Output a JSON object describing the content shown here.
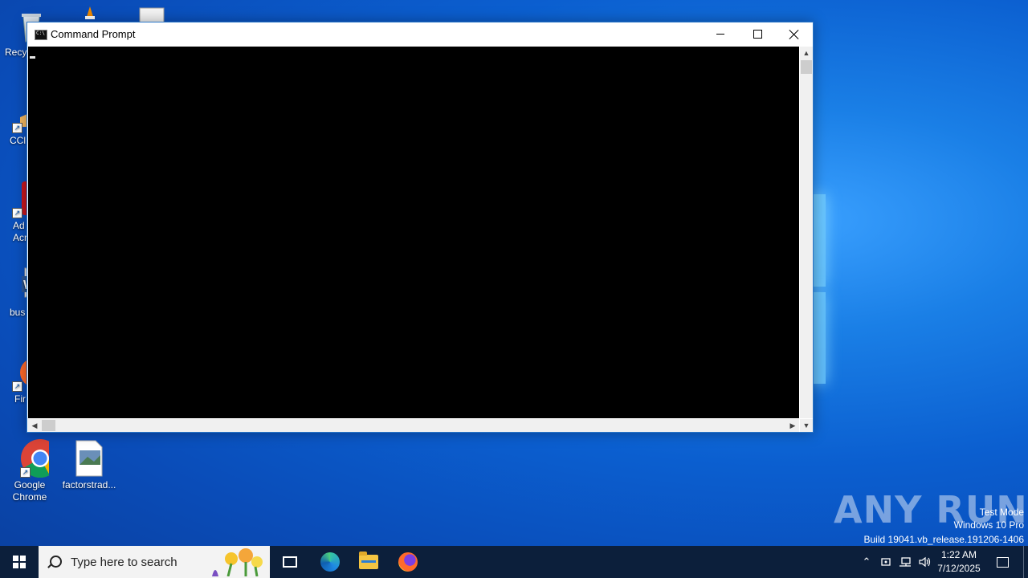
{
  "desktop": {
    "icons": [
      {
        "label": "Recy",
        "icon": "recycle-bin-icon"
      },
      {
        "label": "CCl",
        "icon": "ccleaner-icon"
      },
      {
        "label": "Ad Acr",
        "icon": "acrobat-icon"
      },
      {
        "label": "bus",
        "icon": "word-document-icon"
      },
      {
        "label": "Fir",
        "icon": "firefox-icon"
      },
      {
        "label": "Google Chrome",
        "icon": "chrome-icon"
      },
      {
        "label": "factorstrad...",
        "icon": "image-file-icon"
      }
    ]
  },
  "window": {
    "title": "Command Prompt",
    "icon": "cmd-icon",
    "controls": {
      "minimize": "minimize",
      "maximize": "maximize",
      "close": "close"
    }
  },
  "watermark": {
    "brand": "ANY RUN",
    "line1": "Test Mode",
    "line2": "Windows 10 Pro",
    "line3": "Build 19041.vb_release.191206-1406"
  },
  "taskbar": {
    "search_placeholder": "Type here to search",
    "pinned": [
      "task-view-icon",
      "edge-icon",
      "file-explorer-icon",
      "firefox-icon"
    ],
    "tray": {
      "time": "1:22 AM",
      "date": "7/12/2025",
      "icons": [
        "chevron-up-icon",
        "network-adapter-icon",
        "network-icon",
        "volume-icon"
      ]
    }
  }
}
